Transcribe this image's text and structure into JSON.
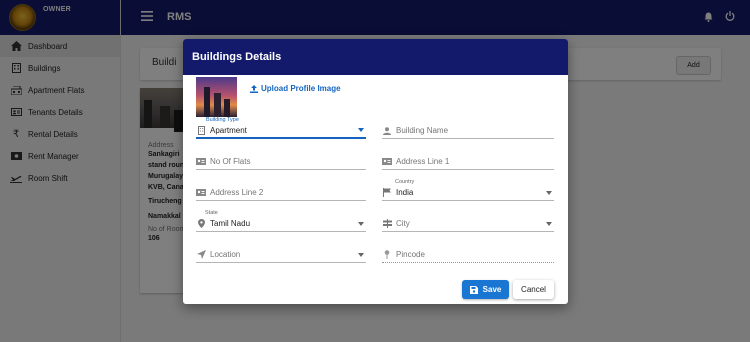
{
  "sidebar": {
    "role": "OWNER",
    "items": [
      {
        "label": "Dashboard",
        "icon": "home-icon",
        "active": true
      },
      {
        "label": "Buildings",
        "icon": "building-icon"
      },
      {
        "label": "Apartment Flats",
        "icon": "apartment-icon"
      },
      {
        "label": "Tenants Details",
        "icon": "id-card-icon"
      },
      {
        "label": "Rental Details",
        "icon": "rupee-icon"
      },
      {
        "label": "Rent Manager",
        "icon": "money-icon"
      },
      {
        "label": "Room Shift",
        "icon": "flight-icon"
      }
    ]
  },
  "topbar": {
    "title": "RMS"
  },
  "page": {
    "title": "Buildi",
    "add_label": "Add",
    "card": {
      "address_label": "Address",
      "address_lines": [
        "Sankagiri",
        "stand roun",
        "Murugalay",
        "KVB, Cana",
        "Tirucheng",
        "Namakkal"
      ],
      "rooms_label": "No of Room",
      "rooms_value": "106"
    }
  },
  "dialog": {
    "title": "Buildings Details",
    "upload_label": "Upload Profile Image",
    "building_type": {
      "label": "Building Type",
      "value": "Apartment"
    },
    "building_name": {
      "placeholder": "Building Name"
    },
    "no_of_flats": {
      "placeholder": "No Of Flats"
    },
    "address_line1": {
      "placeholder": "Address Line 1"
    },
    "address_line2": {
      "placeholder": "Address Line 2"
    },
    "country": {
      "label": "Country",
      "value": "India"
    },
    "state": {
      "label": "State",
      "value": "Tamil Nadu"
    },
    "city": {
      "placeholder": "City"
    },
    "location": {
      "placeholder": "Location"
    },
    "pincode": {
      "placeholder": "Pincode"
    },
    "save_label": "Save",
    "cancel_label": "Cancel"
  },
  "colors": {
    "primary": "#141a6b",
    "accent": "#1565c0",
    "save": "#1976d2"
  }
}
